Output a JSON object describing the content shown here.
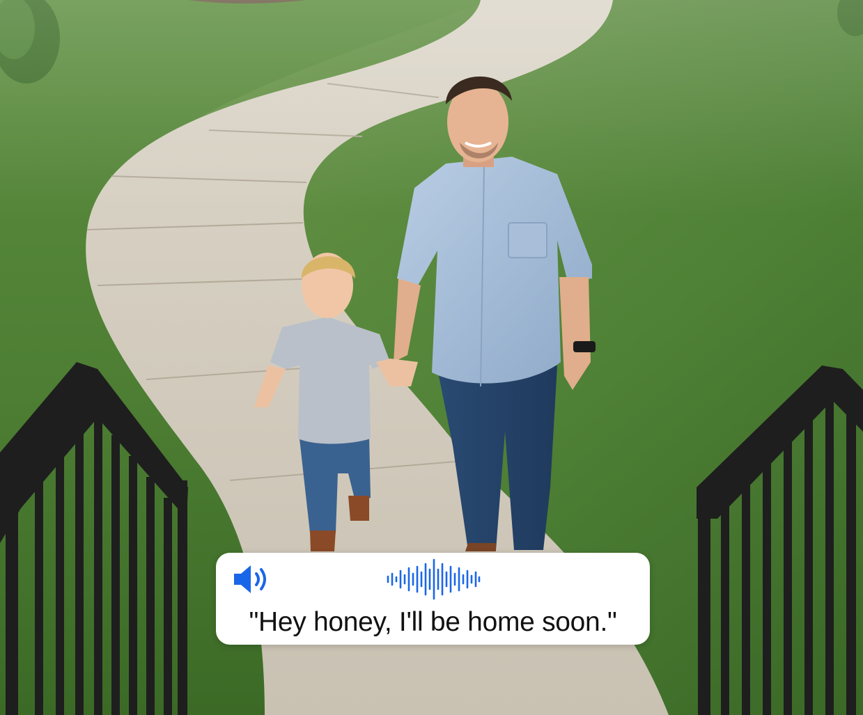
{
  "scene": {
    "subjects": [
      "man",
      "child",
      "sidewalk",
      "lawn",
      "stair-railings"
    ]
  },
  "audio_card": {
    "speaker_icon": "speaker-volume-icon",
    "waveform_icon": "audio-waveform-icon",
    "accent_color": "#1a66e8",
    "transcript": "\"Hey honey, I'll be home soon.\""
  }
}
